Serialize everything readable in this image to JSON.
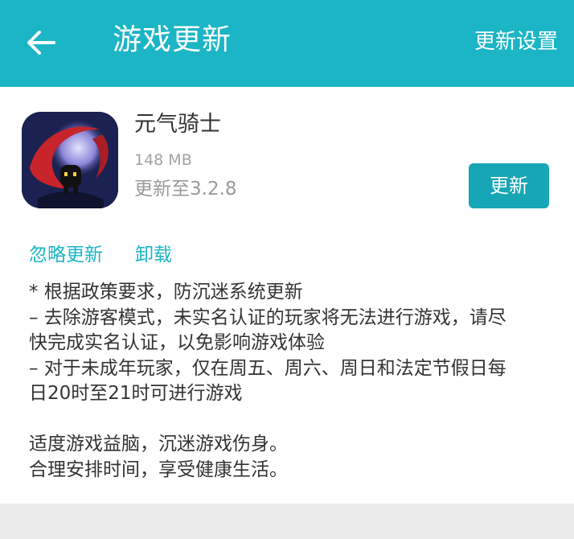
{
  "header": {
    "title": "游戏更新",
    "settings_label": "更新设置",
    "back_icon": "arrow-left-icon",
    "background_color": "#1bb5c6"
  },
  "app": {
    "name": "元气骑士",
    "size": "148 MB",
    "version_text": "更新至3.2.8",
    "update_label": "更新",
    "update_color": "#17a6b5"
  },
  "actions": {
    "ignore_label": "忽略更新",
    "uninstall_label": "卸载"
  },
  "release_notes": [
    "* 根据政策要求，防沉迷系统更新",
    "– 去除游客模式，未实名认证的玩家将无法进行游戏，请尽",
    "快完成实名认证，以免影响游戏体验",
    "– 对于未成年玩家，仅在周五、周六、周日和法定节假日每",
    "日20时至21时可进行游戏",
    "",
    "适度游戏益脑，沉迷游戏伤身。",
    "合理安排时间，享受健康生活。"
  ]
}
